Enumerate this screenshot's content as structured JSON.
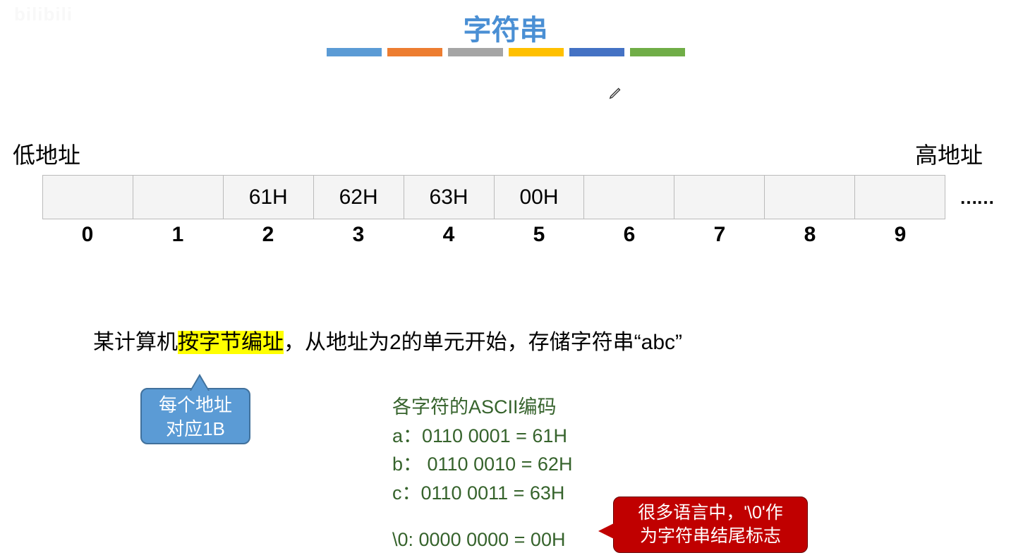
{
  "logo": "bilibili",
  "title": "字符串",
  "labels": {
    "low": "低地址",
    "high": "高地址",
    "ellipsis": "……"
  },
  "memory": {
    "cells": [
      "",
      "",
      "61H",
      "62H",
      "63H",
      "00H",
      "",
      "",
      "",
      ""
    ],
    "indices": [
      "0",
      "1",
      "2",
      "3",
      "4",
      "5",
      "6",
      "7",
      "8",
      "9"
    ]
  },
  "description": {
    "pre": "某计算机",
    "highlight": "按字节编址",
    "post": "，从地址为2的单元开始，存储字符串“abc”"
  },
  "callout_blue": {
    "line1": "每个地址",
    "line2": "对应1B"
  },
  "ascii": {
    "title": "各字符的ASCII编码",
    "a": "a：0110 0001 = 61H",
    "b": "b： 0110 0010 = 62H",
    "c": "c：0110 0011 = 63H",
    "null": "\\0: 0000 0000 = 00H"
  },
  "callout_red": {
    "line1": "很多语言中，'\\0'作",
    "line2": "为字符串结尾标志"
  }
}
